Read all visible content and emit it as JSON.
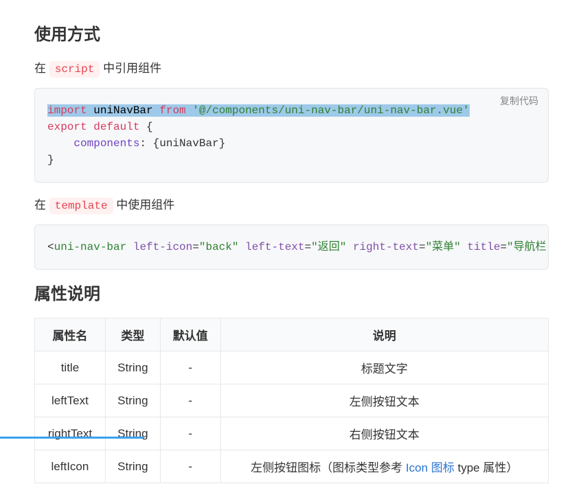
{
  "heading_usage": "使用方式",
  "para_script_prefix": "在 ",
  "code_script": "script",
  "para_script_suffix": " 中引用组件",
  "copy_label": "复制代码",
  "code1": {
    "kw_import": "import",
    "var_uniNavBar": "uniNavBar",
    "kw_from": "from",
    "str_path": "'@/components/uni-nav-bar/uni-nav-bar.vue'",
    "kw_export": "export",
    "kw_default": "default",
    "brace_open": " {",
    "components_key": "components",
    "components_val": ": {uniNavBar}",
    "brace_close": "}"
  },
  "para_template_prefix": "在 ",
  "code_template": "template",
  "para_template_suffix": " 中使用组件",
  "code2": {
    "lt": "<",
    "tag": "uni-nav-bar",
    "a1": "left-icon",
    "v1": "\"back\"",
    "a2": "left-text",
    "v2": "\"返回\"",
    "a3": "right-text",
    "v3": "\"菜单\"",
    "a4": "title",
    "v4": "\"导航栏"
  },
  "heading_props": "属性说明",
  "table": {
    "headers": [
      "属性名",
      "类型",
      "默认值",
      "说明"
    ],
    "rows": [
      [
        "title",
        "String",
        "-",
        "标题文字"
      ],
      [
        "leftText",
        "String",
        "-",
        "左侧按钮文本"
      ],
      [
        "rightText",
        "String",
        "-",
        "右侧按钮文本"
      ]
    ],
    "lastrow": {
      "name": "leftIcon",
      "type": "String",
      "default": "-",
      "desc_pre": "左侧按钮图标（图标类型参考 ",
      "link": "Icon 图标",
      "desc_post": " type 属性）"
    }
  }
}
